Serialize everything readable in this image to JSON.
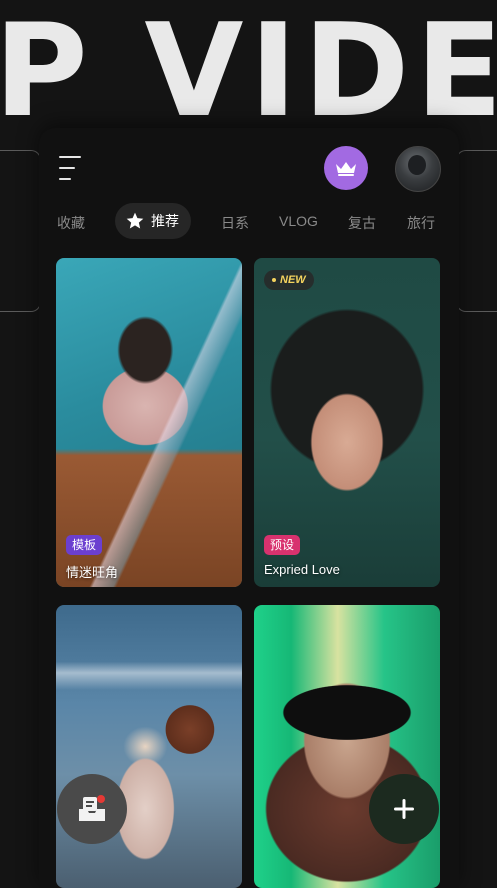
{
  "backdrop": {
    "title": "P VIDE"
  },
  "header": {
    "menu_icon": "menu-icon",
    "vip_icon": "crown-icon",
    "vip_color": "#a26ae2",
    "avatar_icon": "avatar"
  },
  "tabs": [
    {
      "label": "收藏",
      "active": false
    },
    {
      "label": "推荐",
      "active": true,
      "icon": "star-icon"
    },
    {
      "label": "日系",
      "active": false
    },
    {
      "label": "VLOG",
      "active": false
    },
    {
      "label": "复古",
      "active": false
    },
    {
      "label": "旅行",
      "active": false
    }
  ],
  "cards": [
    {
      "badge": "模板",
      "badge_color": "#6b3fd0",
      "title": "情迷旺角",
      "tag": ""
    },
    {
      "badge": "预设",
      "badge_color": "#d8326e",
      "title": "Expried Love",
      "tag": "NEW"
    },
    {
      "badge": "",
      "title": "",
      "tag": ""
    },
    {
      "badge": "",
      "title": "",
      "tag": ""
    }
  ],
  "fab": {
    "inbox_icon": "inbox-icon",
    "notification_dot_color": "#e53935",
    "add_icon": "plus-icon"
  }
}
